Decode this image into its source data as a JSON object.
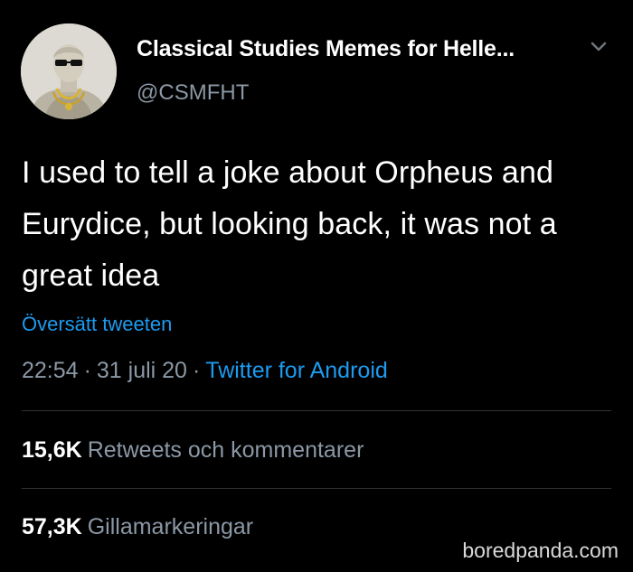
{
  "author": {
    "display_name": "Classical Studies Memes for Helle...",
    "handle": "@CSMFHT",
    "avatar_icon": "statue-with-sunglasses-avatar"
  },
  "tweet": {
    "text": "I used to tell a joke about Orpheus and Eurydice, but looking back, it was not a great idea",
    "translate_label": "Översätt tweeten",
    "time": "22:54",
    "date": "31 juli 20",
    "separator": "·",
    "source": "Twitter for Android"
  },
  "stats": {
    "retweets": {
      "count": "15,6K",
      "label": "Retweets och kommentarer"
    },
    "likes": {
      "count": "57,3K",
      "label": "Gillamarkeringar"
    }
  },
  "watermark": "boredpanda.com",
  "colors": {
    "background": "#000000",
    "text": "#ffffff",
    "secondary": "#8b98a5",
    "link": "#1d9bf0",
    "divider": "#2f3336"
  }
}
